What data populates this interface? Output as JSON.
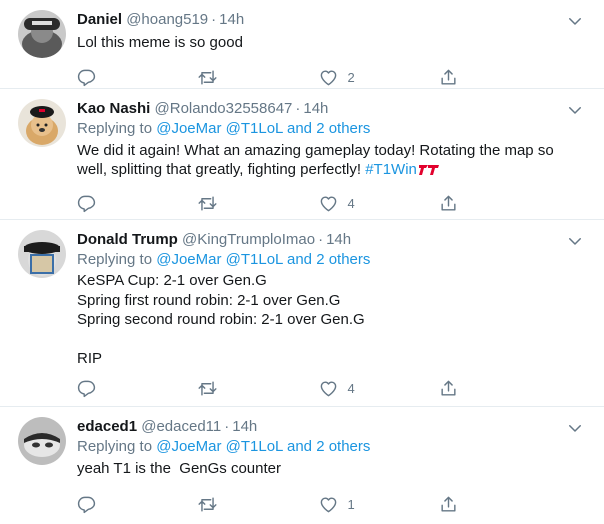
{
  "colors": {
    "link": "#1b95e0",
    "muted": "#657786",
    "border": "#e6ecf0"
  },
  "tweets": [
    {
      "name": "Daniel",
      "handle": "@hoang519",
      "time": "14h",
      "replying_label": "",
      "text": "Lol this meme is so good",
      "hashtag": "",
      "likes": "2"
    },
    {
      "name": "Kao Nashi",
      "handle": "@Rolando32558647",
      "time": "14h",
      "replying_label": "Replying to",
      "mentions": "@JoeMar @T1LoL and 2 others",
      "text": "We did it again! What an amazing gameplay today! Rotating the map so well, splitting that greatly, fighting perfectly! ",
      "hashtag": "#T1Win",
      "likes": "4"
    },
    {
      "name": "Donald Trump",
      "handle": "@KingTrumploImao",
      "time": "14h",
      "replying_label": "Replying to",
      "mentions": "@JoeMar @T1LoL and 2 others",
      "text": "KeSPA Cup: 2-1 over Gen.G\nSpring first round robin: 2-1 over Gen.G\nSpring second round robin: 2-1 over Gen.G\n\nRIP",
      "hashtag": "",
      "likes": "4"
    },
    {
      "name": "edaced1",
      "handle": "@edaced11",
      "time": "14h",
      "replying_label": "Replying to",
      "mentions": "@JoeMar @T1LoL and 2 others",
      "text": "yeah T1 is the  GenGs counter",
      "hashtag": "",
      "likes": "1"
    }
  ],
  "icons": {
    "reply": "reply-icon",
    "retweet": "retweet-icon",
    "like": "heart-icon",
    "share": "share-icon",
    "menu": "chevron-down-icon"
  }
}
